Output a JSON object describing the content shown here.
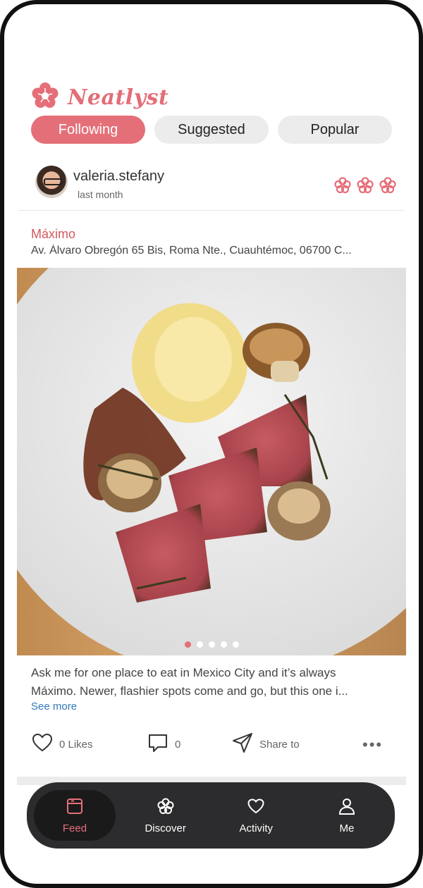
{
  "app": {
    "name": "Neatlyst",
    "accent": "#e56f79"
  },
  "tabs": [
    {
      "label": "Following",
      "active": true
    },
    {
      "label": "Suggested",
      "active": false
    },
    {
      "label": "Popular",
      "active": false
    }
  ],
  "post": {
    "username": "valeria.stefany",
    "timestamp": "last month",
    "rating_icons": [
      "flower-icon",
      "flower-icon",
      "flower-icon"
    ],
    "restaurant": "Máximo",
    "address": "Av. Álvaro Obregón 65 Bis, Roma Nte., Cuauhtémoc, 06700 C...",
    "photo_alt_icon": "food-photo",
    "carousel": {
      "count": 5,
      "active_index": 0
    },
    "caption_line1": "Ask me for one place to eat in Mexico City and it’s always",
    "caption_line2": "Máximo. Newer, flashier spots come and go, but this one i...",
    "see_more": "See more",
    "likes_label": "0 Likes",
    "comments_label": "0",
    "share_label": "Share to",
    "more_label": "•••"
  },
  "bottom_nav": [
    {
      "label": "Feed",
      "icon": "feed-icon",
      "active": true
    },
    {
      "label": "Discover",
      "icon": "discover-icon",
      "active": false
    },
    {
      "label": "Activity",
      "icon": "heart-icon",
      "active": false
    },
    {
      "label": "Me",
      "icon": "profile-icon",
      "active": false
    }
  ]
}
